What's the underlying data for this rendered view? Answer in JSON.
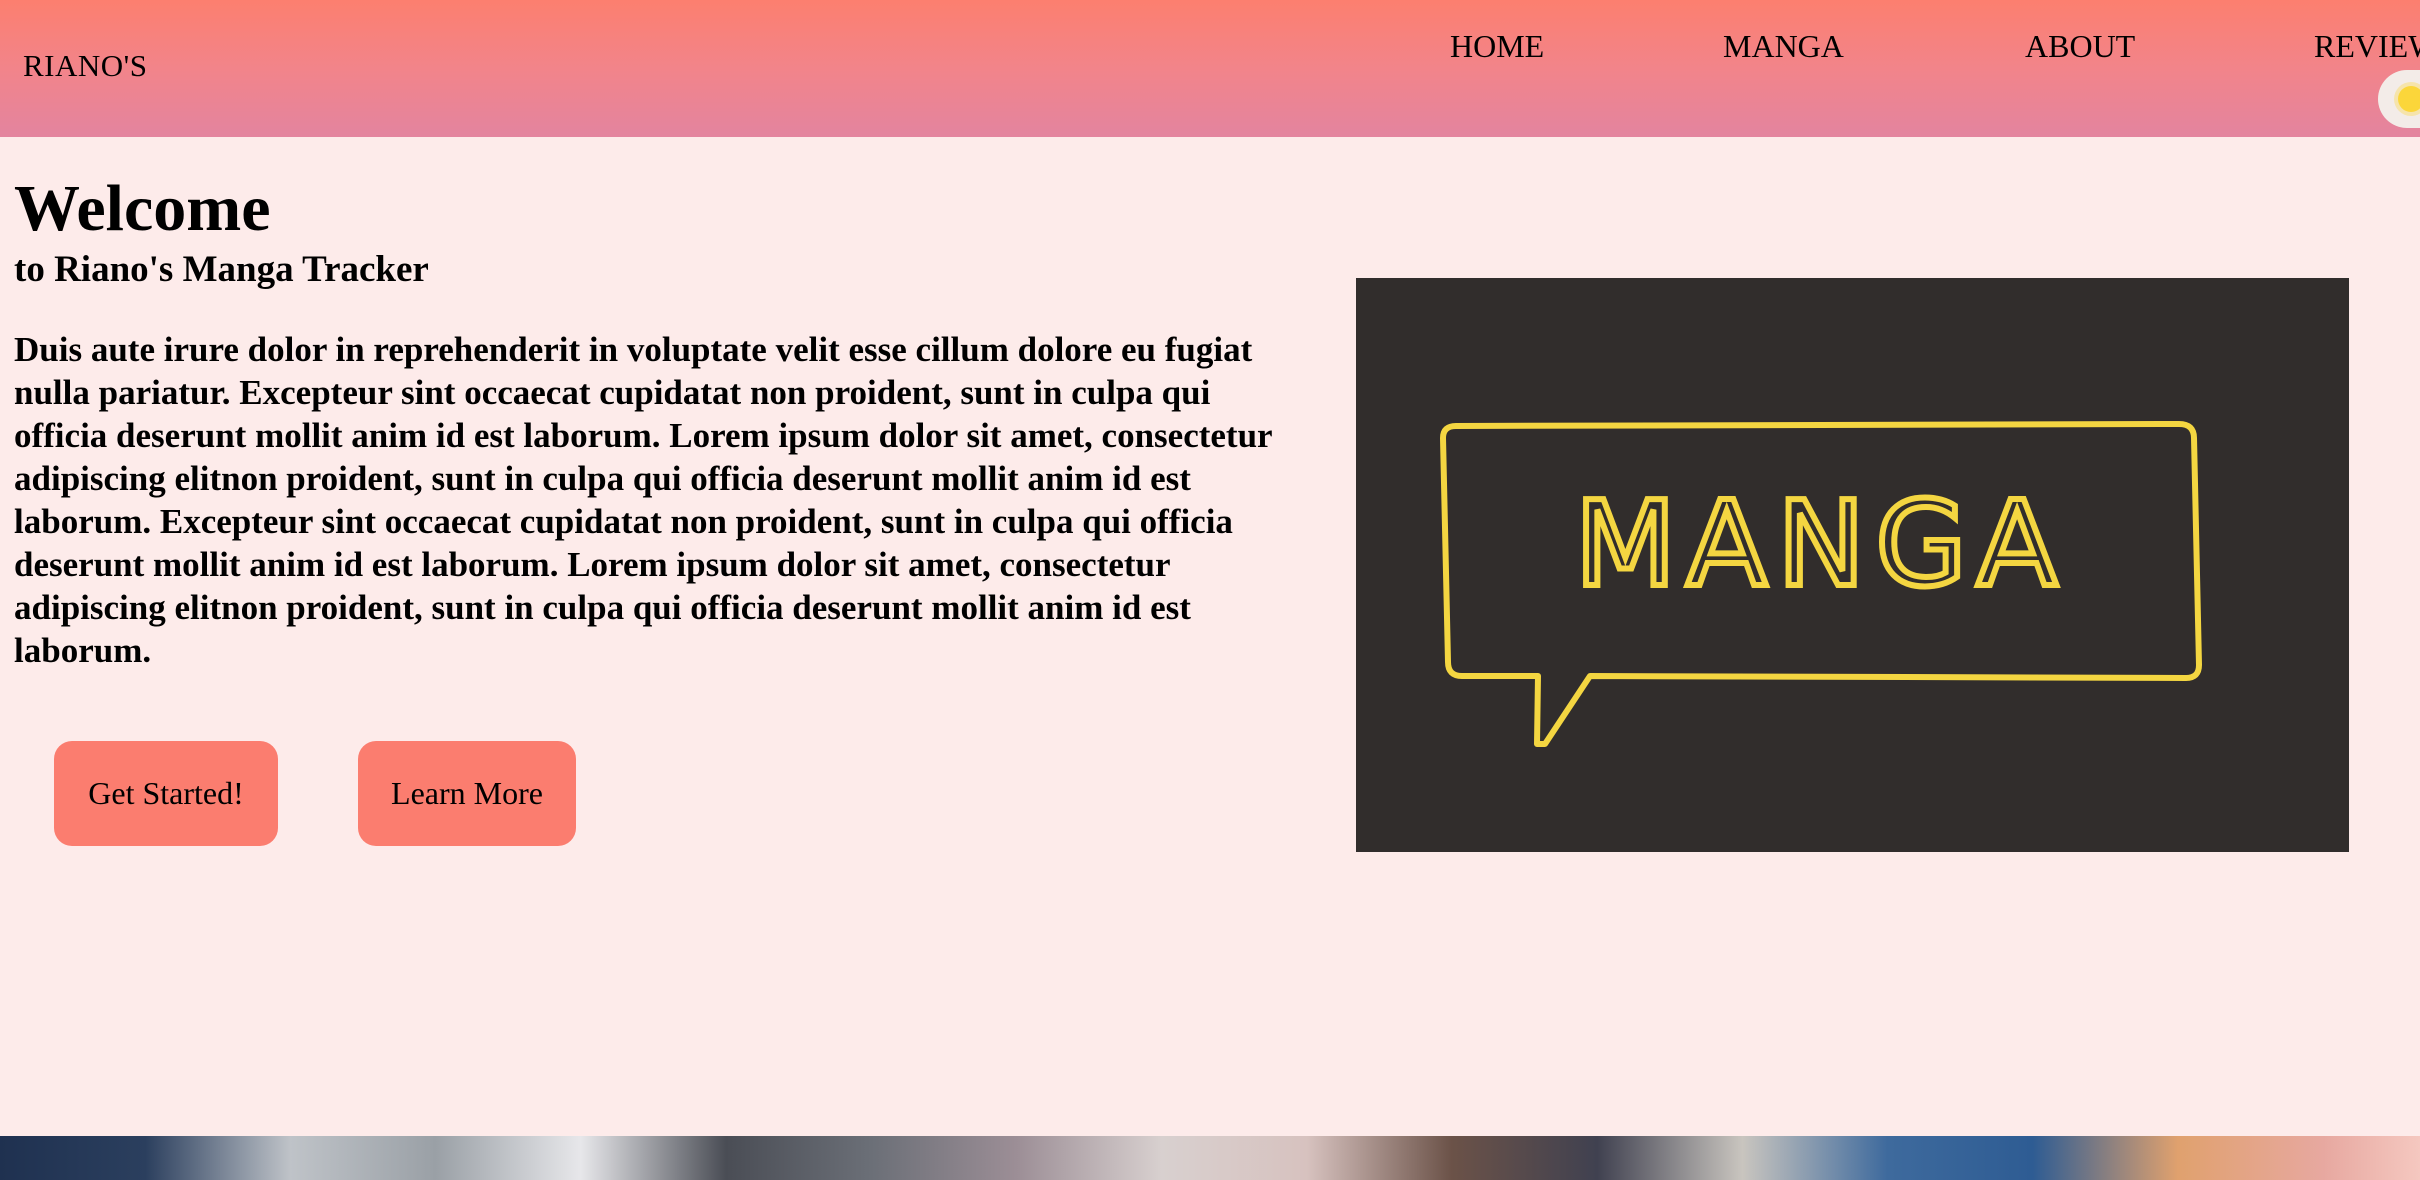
{
  "header": {
    "brand": "RIANO'S",
    "nav": [
      "HOME",
      "MANGA",
      "ABOUT",
      "REVIEWS"
    ],
    "theme_toggle_icon": "sun-icon"
  },
  "hero": {
    "title": "Welcome",
    "subtitle": "to Riano's Manga Tracker",
    "paragraph": "Duis aute irure dolor in reprehenderit in voluptate velit esse cillum dolore eu fugiat nulla pariatur. Excepteur sint occaecat cupidatat non proident, sunt in culpa qui officia deserunt mollit anim id est laborum. Lorem ipsum dolor sit amet, consectetur adipiscing elitnon proident, sunt in culpa qui officia deserunt mollit anim id est laborum. Excepteur sint occaecat cupidatat non proident, sunt in culpa qui officia deserunt mollit anim id est laborum. Lorem ipsum dolor sit amet, consectetur adipiscing elitnon proident, sunt in culpa qui officia deserunt mollit anim id est laborum.",
    "buttons": {
      "get_started": "Get Started!",
      "learn_more": "Learn More"
    },
    "image_sign_text": "MANGA"
  },
  "colors": {
    "header_top": "#fc7f6f",
    "header_bottom": "#e3849f",
    "background": "#fdebea",
    "button": "#fb7d6f",
    "image_bg": "#312d2c",
    "neon": "#f4d641"
  }
}
